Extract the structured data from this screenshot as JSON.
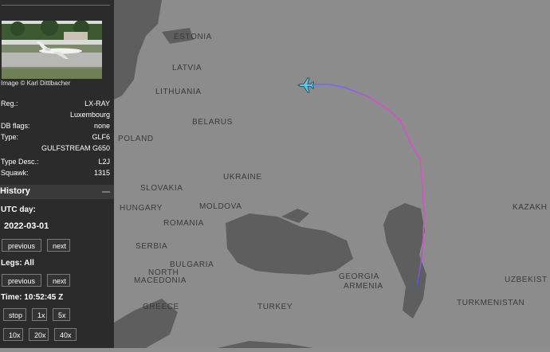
{
  "aircraft": {
    "photo_credit": "Image © Karl Dittlbacher",
    "reg_label": "Reg.:",
    "reg_value": "LX-RAY",
    "country": "Luxembourg",
    "db_flags_label": "DB flags:",
    "db_flags_value": "none",
    "type_label": "Type:",
    "type_value": "GLF6",
    "type_name": "GULFSTREAM G650",
    "type_desc_label": "Type Desc.:",
    "type_desc_value": "L2J",
    "squawk_label": "Squawk:",
    "squawk_value": "1315"
  },
  "history": {
    "title": "History",
    "utc_day_label": "UTC day:",
    "utc_day_value": "2022-03-01",
    "previous_label": "previous",
    "next_label": "next",
    "legs_label": "Legs: All",
    "time_label": "Time: 10:52:45 Z",
    "playback_buttons": [
      "stop",
      "1x",
      "5x"
    ],
    "speed_buttons": [
      "10x",
      "20x",
      "40x"
    ]
  },
  "map": {
    "countries": [
      "ESTONIA",
      "LATVIA",
      "LITHUANIA",
      "BELARUS",
      "POLAND",
      "UKRAINE",
      "SLOVAKIA",
      "HUNGARY",
      "MOLDOVA",
      "ROMANIA",
      "SERBIA",
      "BULGARIA",
      "NORTH",
      "MACEDONIA",
      "GREECE",
      "TURKEY",
      "GEORGIA",
      "ARMENIA",
      "TURKMENISTAN",
      "UZBEKIST",
      "KAZAKH"
    ],
    "track_colors": [
      "#d94fc8",
      "#b04fe0",
      "#6b6bf0"
    ],
    "aircraft_icon": "plane-icon",
    "aircraft_color": "#58c7e8"
  }
}
